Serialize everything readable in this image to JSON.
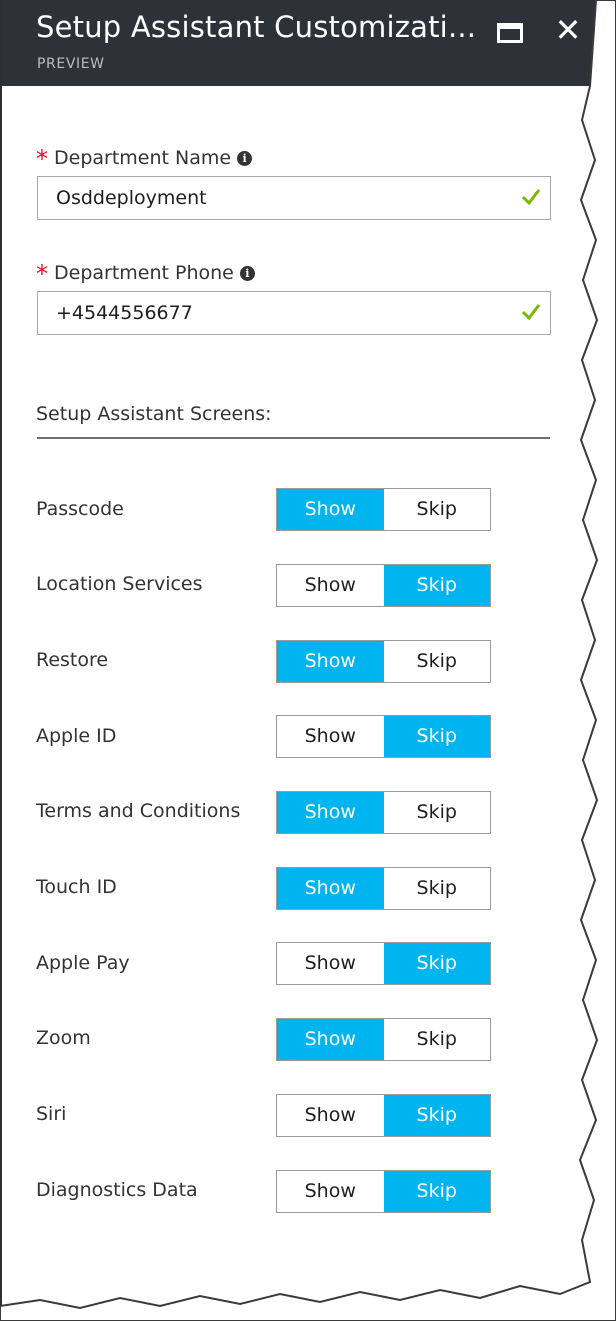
{
  "header": {
    "title": "Setup Assistant Customizati...",
    "subtitle": "PREVIEW",
    "maximize_icon": "maximize-icon",
    "close_icon": "close-icon",
    "close_glyph": "✕"
  },
  "form": {
    "department_name": {
      "required_mark": "*",
      "label": "Department Name",
      "info_glyph": "i",
      "value": "Osddeployment",
      "valid": true
    },
    "department_phone": {
      "required_mark": "*",
      "label": "Department Phone",
      "info_glyph": "i",
      "value": "+4544556677",
      "valid": true
    }
  },
  "screens": {
    "title": "Setup Assistant Screens:",
    "show_label": "Show",
    "skip_label": "Skip",
    "items": [
      {
        "label": "Passcode",
        "selected": "Show"
      },
      {
        "label": "Location Services",
        "selected": "Skip"
      },
      {
        "label": "Restore",
        "selected": "Show"
      },
      {
        "label": "Apple ID",
        "selected": "Skip"
      },
      {
        "label": "Terms and Conditions",
        "selected": "Show"
      },
      {
        "label": "Touch ID",
        "selected": "Show"
      },
      {
        "label": "Apple Pay",
        "selected": "Skip"
      },
      {
        "label": "Zoom",
        "selected": "Show"
      },
      {
        "label": "Siri",
        "selected": "Skip"
      },
      {
        "label": "Diagnostics Data",
        "selected": "Skip"
      }
    ]
  },
  "colors": {
    "header_bg": "#2c3238",
    "accent": "#00b4f0",
    "required": "#e81123",
    "valid_check": "#7ab800"
  }
}
